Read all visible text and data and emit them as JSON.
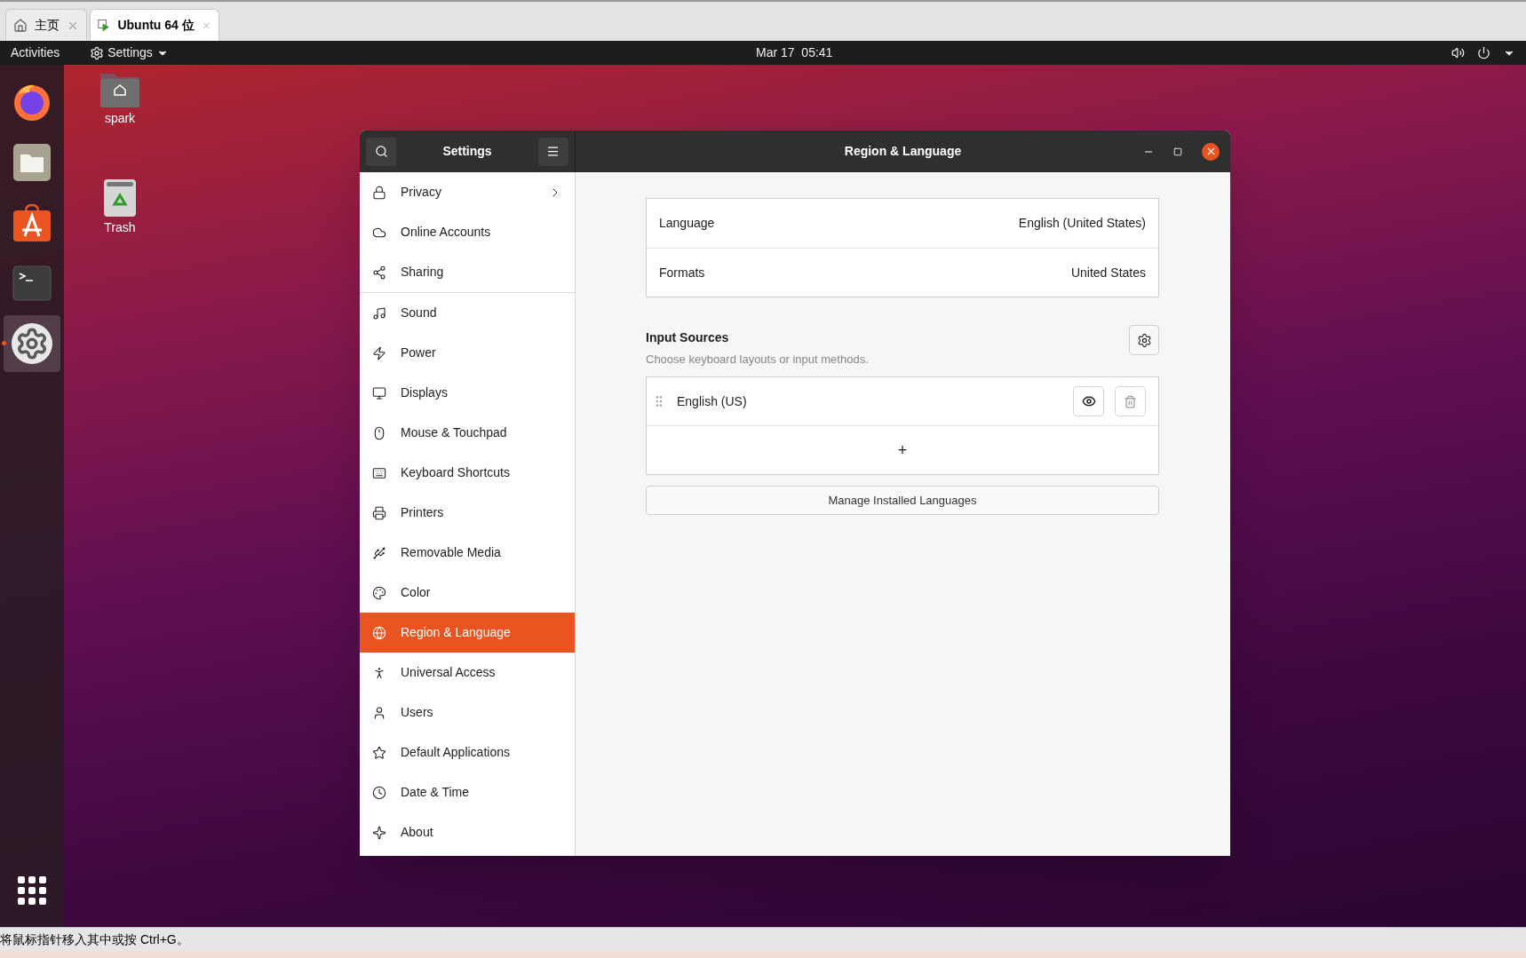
{
  "browser_tabs": [
    {
      "kind": "home",
      "label": "主页",
      "selected": false
    },
    {
      "kind": "vm",
      "label": "Ubuntu 64 位",
      "selected": true
    }
  ],
  "top_bar": {
    "activities": "Activities",
    "app_menu": "Settings",
    "clock": "Mar 17  05:41"
  },
  "dock": [
    {
      "kind": "firefox",
      "selected": false
    },
    {
      "kind": "files",
      "selected": false
    },
    {
      "kind": "store",
      "selected": false
    },
    {
      "kind": "terminal",
      "selected": false
    },
    {
      "kind": "settings",
      "selected": true
    }
  ],
  "desktop_icons": [
    {
      "kind": "folder",
      "label": "spark"
    },
    {
      "kind": "trash",
      "label": "Trash"
    }
  ],
  "settings": {
    "sidebar_title": "Settings",
    "title": "Region & Language",
    "sidebar_groups": [
      {
        "items": [
          {
            "kind": "lock",
            "label": "Privacy",
            "selected": false,
            "submenu": true
          },
          {
            "kind": "cloud",
            "label": "Online Accounts",
            "selected": false,
            "submenu": false
          },
          {
            "kind": "share",
            "label": "Sharing",
            "selected": false,
            "submenu": false
          }
        ]
      },
      {
        "items": [
          {
            "kind": "music",
            "label": "Sound",
            "selected": false,
            "submenu": false
          },
          {
            "kind": "power",
            "label": "Power",
            "selected": false,
            "submenu": false
          },
          {
            "kind": "monitor",
            "label": "Displays",
            "selected": false,
            "submenu": false
          },
          {
            "kind": "mouse",
            "label": "Mouse & Touchpad",
            "selected": false,
            "submenu": false
          },
          {
            "kind": "keyboard",
            "label": "Keyboard Shortcuts",
            "selected": false,
            "submenu": false
          },
          {
            "kind": "printer",
            "label": "Printers",
            "selected": false,
            "submenu": false
          },
          {
            "kind": "media",
            "label": "Removable Media",
            "selected": false,
            "submenu": false
          },
          {
            "kind": "color",
            "label": "Color",
            "selected": false,
            "submenu": false
          },
          {
            "kind": "globe",
            "label": "Region & Language",
            "selected": true,
            "submenu": false
          },
          {
            "kind": "access",
            "label": "Universal Access",
            "selected": false,
            "submenu": false
          },
          {
            "kind": "user",
            "label": "Users",
            "selected": false,
            "submenu": false
          },
          {
            "kind": "star",
            "label": "Default Applications",
            "selected": false,
            "submenu": false
          },
          {
            "kind": "clock",
            "label": "Date & Time",
            "selected": false,
            "submenu": false
          },
          {
            "kind": "sparkle",
            "label": "About",
            "selected": false,
            "submenu": false
          }
        ]
      }
    ],
    "region_rows": [
      {
        "label": "Language",
        "value": "English (United States)"
      },
      {
        "label": "Formats",
        "value": "United States"
      }
    ],
    "input_sources": {
      "title": "Input Sources",
      "subtitle": "Choose keyboard layouts or input methods.",
      "sources": [
        {
          "name": "English (US)"
        }
      ],
      "add_button": "+",
      "manage_button": "Manage Installed Languages"
    }
  },
  "status_bar": {
    "text": "将鼠标指针移入其中或按 Ctrl+G。"
  }
}
